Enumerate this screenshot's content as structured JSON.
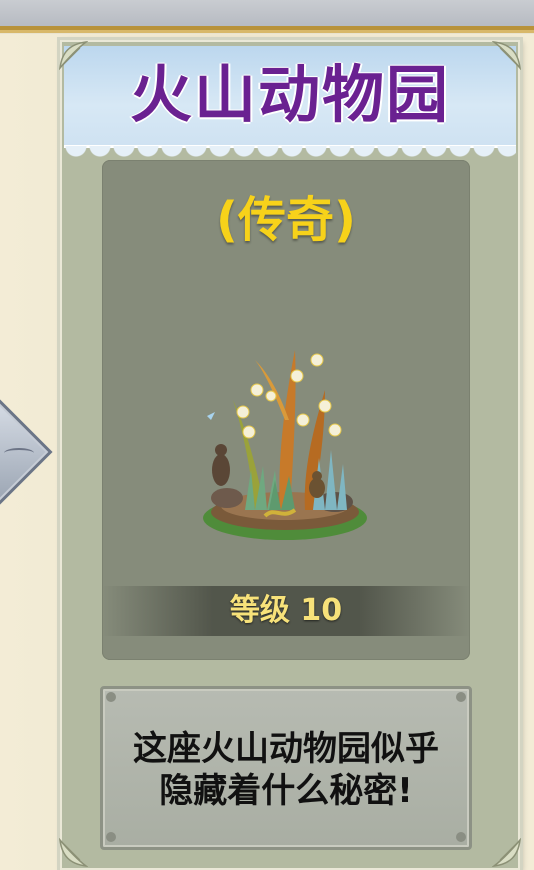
{
  "card": {
    "title": "火山动物园",
    "rarity": "(传奇)",
    "level_label": "等级",
    "level_value": "10",
    "description_line1": "这座火山动物园似乎",
    "description_line2": "隐藏着什么秘密!"
  },
  "colors": {
    "title": "#6a2191",
    "rarity": "#f7d21a",
    "level_text": "#f7e27a",
    "banner": "#cfe2f2",
    "panel": "#868c7b",
    "card_frame": "#b3baa1"
  },
  "icons": {
    "zoo_image": "volcano-zoo-illustration",
    "corner_leaf": "leaf-ornament-icon",
    "side_ornament": "diamond-ornament"
  }
}
